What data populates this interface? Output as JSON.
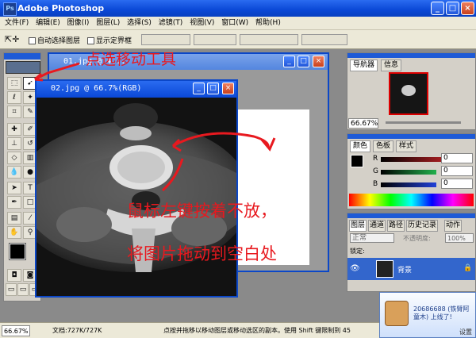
{
  "app": {
    "title": "Adobe Photoshop",
    "icon_text": "Ps"
  },
  "menu": [
    "文件(F)",
    "编辑(E)",
    "图像(I)",
    "图层(L)",
    "选择(S)",
    "滤镜(T)",
    "视图(V)",
    "窗口(W)",
    "帮助(H)"
  ],
  "options": {
    "auto_select": "自动选择图层",
    "show_bounds": "显示定界框"
  },
  "documents": [
    {
      "title": "01.jpg @ 4..."
    },
    {
      "title": "02.jpg @ 66.7%(RGB)"
    }
  ],
  "annotations": {
    "tool_hint": "点选移动工具",
    "drag_hint_1": "鼠标左键按着不放，",
    "drag_hint_2": "将图片拖动到空白处"
  },
  "navigator": {
    "tabs": [
      "导航器",
      "信息"
    ],
    "zoom": "66.67%"
  },
  "color_panel": {
    "tabs": [
      "颜色",
      "色板",
      "样式"
    ],
    "channels": [
      {
        "label": "R",
        "value": "0",
        "color": "#e0282c"
      },
      {
        "label": "G",
        "value": "0",
        "color": "#22b14c"
      },
      {
        "label": "B",
        "value": "0",
        "color": "#2141d8"
      }
    ]
  },
  "layers_panel": {
    "tabs": [
      "图层",
      "通道",
      "路径",
      "历史记录",
      "动作"
    ],
    "blend_mode": "正常",
    "opacity_label": "不透明度:",
    "opacity_value": "100%",
    "lock_label": "锁定:",
    "layer_name": "背景"
  },
  "status": {
    "zoom": "66.67%",
    "doc": "文档:727K/727K",
    "hint": "点按并拖移以移动图层或移动选区的副本。使用 Shift 键限制到 45"
  },
  "notification": {
    "message": "20686688 (铁臂阿童木) 上线了!",
    "settings": "设置"
  },
  "colors": {
    "accent": "#0a48d6",
    "annotation": "#e8191f"
  }
}
